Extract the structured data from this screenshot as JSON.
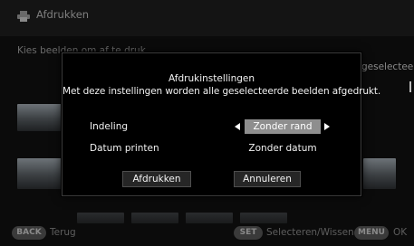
{
  "background": {
    "title": "Afdrukken",
    "subtitle": "Kies beelden om af te druk",
    "status": "geselecteerd",
    "footer": {
      "back_key": "BACK",
      "back_label": "Terug",
      "set_key": "SET",
      "set_label": "Selecteren/Wissen",
      "menu_key": "MENU",
      "menu_label": "OK"
    }
  },
  "dialog": {
    "title": "Afdrukinstellingen",
    "description": "Met deze instellingen worden alle geselecteerde beelden afgedrukt.",
    "layout": {
      "label": "Indeling",
      "value": "Zonder rand"
    },
    "date": {
      "label": "Datum printen",
      "value": "Zonder datum"
    },
    "print_button": "Afdrukken",
    "cancel_button": "Annuleren"
  }
}
